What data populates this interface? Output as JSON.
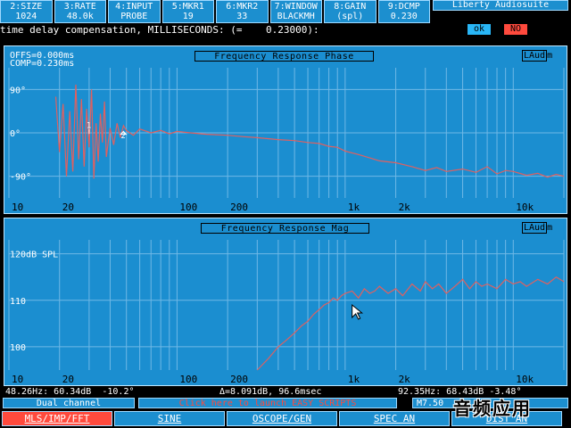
{
  "params": [
    {
      "label": "2:SIZE",
      "value": "1024"
    },
    {
      "label": "3:RATE",
      "value": "48.0k"
    },
    {
      "label": "4:INPUT",
      "value": "PROBE"
    },
    {
      "label": "5:MKR1",
      "value": "19"
    },
    {
      "label": "6:MKR2",
      "value": "33"
    },
    {
      "label": "7:WINDOW",
      "value": "BLACKMH"
    },
    {
      "label": "8:GAIN",
      "value": "(spl)"
    },
    {
      "label": "9:DCMP",
      "value": "0.230"
    }
  ],
  "brand": "Liberty Audiosuite",
  "prompt": "time delay compensation, MILLISECONDS: (=    0.23000):",
  "ok_label": "ok",
  "no_label": "NO",
  "phase_chart": {
    "title": "Frequency Response Phase",
    "logo": "LAud",
    "logo_suffix": "m",
    "offs": "OFFS=0.000ms",
    "comp": "COMP=0.230ms",
    "y_ticks": [
      "90°",
      "0°",
      "-90°"
    ],
    "x_ticks": [
      "10",
      "20",
      "100",
      "200",
      "1k",
      "2k",
      "10k"
    ],
    "marker1": "1",
    "marker2": "2"
  },
  "mag_chart": {
    "title": "Frequency Response Mag",
    "logo": "LAud",
    "logo_suffix": "m",
    "y_unit": "120dB SPL",
    "y_ticks": [
      "110",
      "100"
    ],
    "x_ticks": [
      "10",
      "20",
      "100",
      "200",
      "1k",
      "2k",
      "10k"
    ]
  },
  "chart_data": [
    {
      "type": "line",
      "title": "Frequency Response Phase",
      "xlabel": "",
      "ylabel": "",
      "x_scale": "log",
      "xlim": [
        10,
        20000
      ],
      "ylim": [
        -135,
        135
      ],
      "x_ticks": [
        10,
        20,
        100,
        200,
        1000,
        2000,
        10000
      ],
      "y_ticks": [
        90,
        0,
        -90
      ],
      "grid": true,
      "series": [
        {
          "x": [
            19,
            20,
            21,
            22,
            23,
            24,
            25,
            26,
            27,
            28,
            29,
            30,
            31,
            32,
            33,
            34,
            35,
            36,
            37,
            38,
            40,
            42,
            44,
            46,
            48,
            50,
            55,
            60,
            70,
            80,
            90,
            100,
            120,
            150,
            200,
            250,
            300,
            400,
            500,
            600,
            700,
            800,
            900,
            1000,
            1200,
            1400,
            1600,
            2000,
            2500,
            3000,
            3500,
            4000,
            5000,
            6000,
            7000,
            8000,
            9000,
            10000,
            12000,
            14000,
            16000,
            18000,
            20000
          ],
          "y": [
            75,
            -40,
            60,
            -90,
            45,
            -80,
            100,
            -55,
            70,
            -70,
            50,
            -30,
            90,
            -95,
            20,
            -60,
            40,
            -20,
            65,
            -50,
            10,
            -25,
            20,
            -10,
            15,
            5,
            -5,
            8,
            0,
            5,
            -2,
            3,
            0,
            -3,
            -5,
            -8,
            -10,
            -14,
            -16,
            -20,
            -22,
            -28,
            -30,
            -38,
            -45,
            -52,
            -58,
            -62,
            -70,
            -78,
            -72,
            -80,
            -75,
            -82,
            -70,
            -85,
            -78,
            -80,
            -88,
            -84,
            -92,
            -86,
            -90
          ]
        }
      ]
    },
    {
      "type": "line",
      "title": "Frequency Response Mag",
      "xlabel": "",
      "ylabel": "120dB SPL",
      "x_scale": "log",
      "xlim": [
        10,
        20000
      ],
      "ylim": [
        95,
        123
      ],
      "x_ticks": [
        10,
        20,
        100,
        200,
        1000,
        2000,
        10000
      ],
      "y_ticks": [
        110,
        100
      ],
      "grid": true,
      "series": [
        {
          "x": [
            300,
            350,
            400,
            450,
            500,
            550,
            600,
            650,
            700,
            750,
            800,
            850,
            900,
            950,
            1000,
            1100,
            1200,
            1300,
            1400,
            1500,
            1600,
            1800,
            2000,
            2200,
            2500,
            2800,
            3000,
            3300,
            3600,
            4000,
            4500,
            5000,
            5500,
            6000,
            6500,
            7000,
            8000,
            9000,
            10000,
            11000,
            12000,
            14000,
            16000,
            18000,
            20000
          ],
          "y": [
            95,
            97.5,
            100,
            101.5,
            103,
            104.5,
            105.5,
            107,
            108,
            109,
            109.5,
            110.5,
            110,
            111,
            111.5,
            112,
            110.5,
            112.5,
            111.5,
            112,
            113,
            111.5,
            112.5,
            111,
            113.5,
            112,
            114,
            112.5,
            113.5,
            111.5,
            113,
            114.5,
            112.5,
            114,
            113,
            113.5,
            112.5,
            114.5,
            113.5,
            114,
            113,
            114.5,
            113.5,
            115,
            114
          ]
        }
      ]
    }
  ],
  "readout": {
    "left": "48.26Hz: 60.34dB  -10.2°",
    "mid": "Δ=8.091dB, 96.6msec",
    "right": "92.35Hz: 68.43dB -3.48°"
  },
  "dual_channel": "Dual channel",
  "easy_link": "Click here to launch EASY SCRIPTS",
  "mversion": "M7.50",
  "tabs": [
    {
      "label": "MLS/IMP/FFT",
      "active": true
    },
    {
      "label": "SINE",
      "active": false
    },
    {
      "label": "OSCOPE/GEN",
      "active": false
    },
    {
      "label": "SPEC AN",
      "active": false
    },
    {
      "label": "DIST AN",
      "active": false
    }
  ],
  "watermark": "音频应用",
  "colors": {
    "panel": "#1b8ed0",
    "trace": "#e06060",
    "grid": "#6fb8e6",
    "active_tab": "#ff4a3d"
  }
}
